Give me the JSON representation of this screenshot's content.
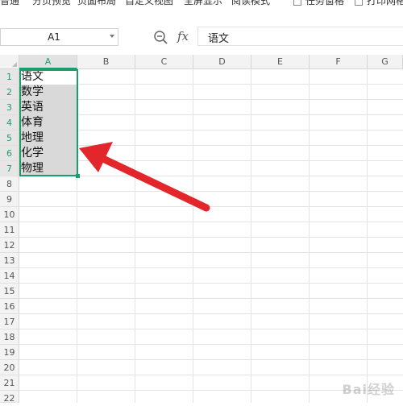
{
  "ribbon": {
    "items": [
      "普通",
      "分页预览",
      "页面布局",
      "自定义视图",
      "全屏显示",
      "阅读模式"
    ],
    "checkboxes": [
      "任务窗格",
      "打印网格"
    ]
  },
  "formula_bar": {
    "name_box": "A1",
    "fx_label": "fx",
    "content": "语文"
  },
  "grid": {
    "columns": [
      "A",
      "B",
      "C",
      "D",
      "E",
      "F",
      "G"
    ],
    "rows": [
      "1",
      "2",
      "3",
      "4",
      "5",
      "6",
      "7",
      "8",
      "9",
      "10",
      "11",
      "12",
      "13",
      "14",
      "15",
      "16",
      "17",
      "18",
      "19",
      "20",
      "21",
      "22"
    ],
    "selected_column": "A",
    "selected_rows": [
      "1",
      "2",
      "3",
      "4",
      "5",
      "6",
      "7"
    ],
    "column_a_values": [
      "语文",
      "数学",
      "英语",
      "体育",
      "地理",
      "化学",
      "物理"
    ]
  },
  "colors": {
    "selection": "#1a9e6b",
    "arrow": "#e3262b"
  },
  "watermark": "Bai经验"
}
